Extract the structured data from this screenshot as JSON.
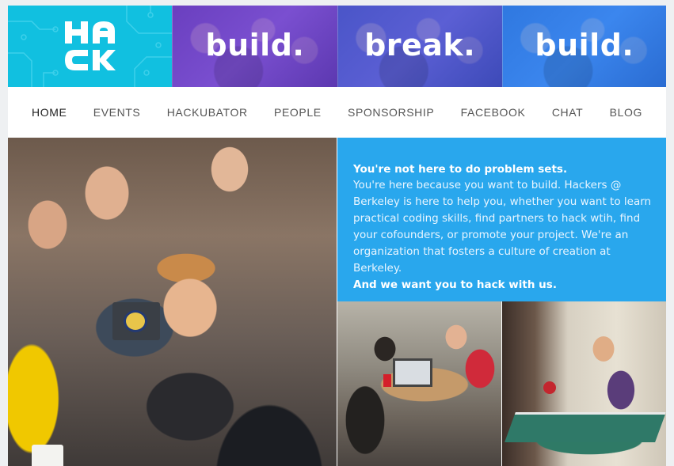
{
  "banner": {
    "logo_alt": "HACK",
    "tiles": [
      {
        "word": "build."
      },
      {
        "word": "break."
      },
      {
        "word": "build."
      }
    ],
    "colors": {
      "logo_bg": "#11c0e0",
      "tile1": "#6a3fbf",
      "tile2": "#4a55c8",
      "tile3": "#2f78e0"
    }
  },
  "nav": {
    "items": [
      {
        "label": "HOME",
        "active": true
      },
      {
        "label": "EVENTS"
      },
      {
        "label": "HACKUBATOR"
      },
      {
        "label": "PEOPLE"
      },
      {
        "label": "SPONSORSHIP"
      },
      {
        "label": "FACEBOOK"
      },
      {
        "label": "CHAT"
      },
      {
        "label": "BLOG"
      }
    ]
  },
  "intro": {
    "heading": "You're not here to do problem sets.",
    "body": "You're here because you want to build. Hackers @ Berkeley is here to help you, whether you want to learn practical coding skills, find partners to hack wtih, find your cofounders, or promote your project. We're an organization that fosters a culture of creation at Berkeley.",
    "cta": "And we want you to hack with us.",
    "bg_color": "#17a0ec"
  }
}
